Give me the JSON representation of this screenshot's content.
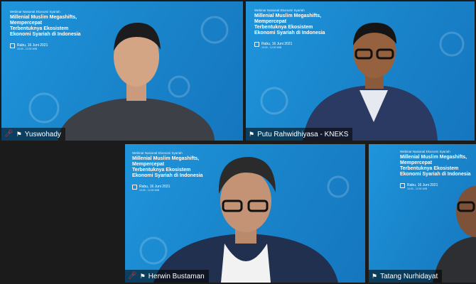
{
  "slide": {
    "kicker": "Webinar Nasional Ekonomi Syariah",
    "title_lines": [
      "Millenial Muslim Megashifts,",
      "Mempercepat",
      "Terbentuknya Ekosistem",
      "Ekonomi Syariah di Indonesia"
    ],
    "date": "Rabu, 16 Juni 2021",
    "time": "10:00 - 12:00 WIB"
  },
  "participants": [
    {
      "name": "Yuswohady",
      "muted": true,
      "active": false
    },
    {
      "name": "Putu Rahwidhiyasa - KNEKS",
      "muted": false,
      "active": true
    },
    {
      "name": "Herwin Bustaman",
      "muted": true,
      "active": false
    },
    {
      "name": "Tatang Nurhidayat",
      "muted": false,
      "active": false
    }
  ],
  "icons": {
    "mic_off": "mic-off-icon",
    "pin": "pin-icon",
    "calendar": "calendar-icon"
  },
  "colors": {
    "active_border": "#f2e24a",
    "slide_bg": "#1a8ad0",
    "muted_mic": "#e53935"
  }
}
